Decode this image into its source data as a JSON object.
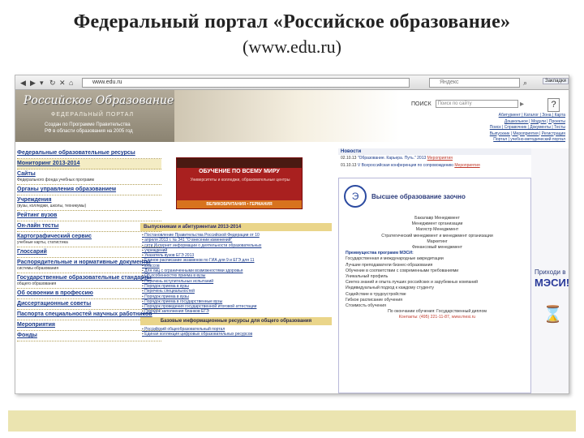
{
  "slide": {
    "title": "Федеральный портал «Российское образование»",
    "url": "(www.edu.ru)"
  },
  "browser": {
    "back_icon": "back-arrow-icon",
    "url": "www.edu.ru",
    "search_placeholder": "Яндекс",
    "side_tab": "Закладки"
  },
  "header": {
    "logo": "Российское Образование",
    "subtitle": "ФЕДЕРАЛЬНЫЙ ПОРТАЛ",
    "desc": "Создан по Программе Правительства РФ в области образования на 2005 год",
    "search_label": "ПОИСК",
    "search_placeholder": "Поиск по сайту",
    "help": "?",
    "links": [
      "Абитуриент | Каталог | Зона | Карта",
      "Дошкольное | Модули | Проекты",
      "Поиск | Справочник | Документы | Тесты",
      "Выпускник | Мероприятия | Регистрация",
      "Портал | учебно-методический портал"
    ]
  },
  "left_menu": [
    {
      "label": "Федеральные образовательные ресурсы",
      "sub": ""
    },
    {
      "label": "Мониторинг 2013-2014",
      "sub": "",
      "highlight": true
    },
    {
      "label": "Сайты",
      "sub": "Федерального фонда учебных программ"
    },
    {
      "label": "Органы управления образованием",
      "sub": ""
    },
    {
      "label": "Учреждения",
      "sub": "(вузы, колледжи, школы, техникумы)"
    },
    {
      "label": "Рейтинг вузов",
      "sub": ""
    },
    {
      "label": "Он-лайн тесты",
      "sub": ""
    },
    {
      "label": "Картографический сервис",
      "sub": "учебные карты, статистика"
    },
    {
      "label": "Глоссарий",
      "sub": ""
    },
    {
      "label": "Распорядительные и нормативные документы",
      "sub": "системы образования"
    },
    {
      "label": "Государственные образовательные стандарты",
      "sub": "общего образования"
    },
    {
      "label": "Об освоении в профессию",
      "sub": ""
    },
    {
      "label": "Диссертационные советы",
      "sub": ""
    },
    {
      "label": "Паспорта специальностей научных работников",
      "sub": ""
    },
    {
      "label": "Мероприятия",
      "sub": ""
    },
    {
      "label": "Фонды",
      "sub": ""
    }
  ],
  "banner": {
    "title": "ОБУЧЕНИЕ ПО ВСЕМУ МИРУ",
    "sub": "Университеты и колледжи, образовательные центры",
    "foot": "ВЕЛИКОБРИТАНИЯ • ГЕРМАНИЯ"
  },
  "center": {
    "header": "Выпускникам и абитуриентам 2013-2014",
    "items": [
      "Постановление Правительства Российской Федерации от 10",
      "апреля 2013 г. № 341 \"О внесении изменений\"",
      "сети Интернет информации о деятельности образовательных",
      "учреждений",
      "Указатель вузов ЕГЭ 2013",
      "Единое расписание экзаменов по ГИА для 9 и ЕГЭ для 11",
      "классов",
      "Для лиц с ограниченными возможностями здоровья",
      "Об особенностях приема в вузы",
      "Перечень вступительных испытаний",
      "Порядок приема в вузы",
      "Перечень специальностей",
      "Порядок приема в вузы",
      "Порядок приема в государственные вузы",
      "Порядок проведения государственной итоговой аттестации",
      "Порядок заполнения бланков ЕГЭ"
    ],
    "sub_header": "Базовые информационные ресурсы для общего образования",
    "sub_items": [
      "Российский общеобразовательный портал",
      "Единая коллекция цифровых образовательных ресурсов"
    ]
  },
  "news": {
    "heading": "Новости",
    "items": [
      {
        "date": "02.10.13",
        "text": "\"Образование. Карьера. Путь.\" 2013",
        "tag": "Мероприятия"
      },
      {
        "date": "01.10.13",
        "text": "V Всероссийская конференция по сопровождению",
        "tag": "Мероприятия"
      }
    ]
  },
  "mesi": {
    "logo": "Э",
    "title": "Высшее образование заочно",
    "lines": [
      "Бакалавр Менеджмент",
      "Менеджмент организации",
      "Магистр Менеджмент",
      "Стратегический менеджмент и менеджмент организации",
      "Маркетинг",
      "Финансовый менеджмент",
      "Преимущества программ МЭСИ:",
      "Государственная и международные аккредитации",
      "Лучшие преподаватели бизнес-образования",
      "Обучение в соответствии с современными требованиями",
      "Уникальный профиль",
      "Синтез знаний и опыта лучших российских и зарубежных компаний",
      "Индивидуальный подход к каждому студенту",
      "Содействие в трудоустройстве",
      "Гибкое расписание обучения",
      "Стоимость обучения",
      "По окончании обучения: Государственный диплом",
      "Контакты: (495) 221-11-87, www.mesi.ru"
    ],
    "ad_line1": "Приходи в",
    "ad_line2": "МЭСИ!"
  }
}
